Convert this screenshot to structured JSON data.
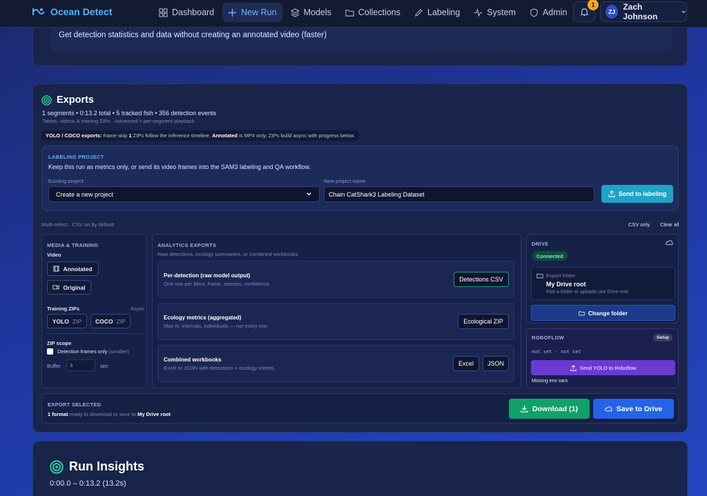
{
  "app": {
    "name": "Ocean Detect"
  },
  "nav": {
    "items": [
      {
        "label": "Dashboard",
        "icon": "dashboard-icon"
      },
      {
        "label": "New Run",
        "icon": "plus-icon"
      },
      {
        "label": "Models",
        "icon": "layers-icon"
      },
      {
        "label": "Collections",
        "icon": "folder-icon"
      },
      {
        "label": "Labeling",
        "icon": "pencil-icon"
      },
      {
        "label": "System",
        "icon": "activity-icon"
      },
      {
        "label": "Admin",
        "icon": "shield-icon"
      }
    ],
    "active": "New Run"
  },
  "notifications": {
    "count": "1"
  },
  "user": {
    "initials": "ZJ",
    "name": "Zach Johnson"
  },
  "top_card": {
    "text": "Get detection statistics and data without creating an annotated video (faster)"
  },
  "exports": {
    "title": "Exports",
    "stats": "1 segments • 0:13.2 total • 5 tracked fish • 356 detection events",
    "substats": "Tables, videos & training ZIPs · Advanced = per-segment playback",
    "notice": {
      "b1": "YOLO / COCO exports:",
      "t1": " frame skip ",
      "b2": "1",
      "t2": " ZIPs follow the inference timeline. ",
      "b3": "Annotated",
      "t3": " is MP4 only; ZIPs build async with progress below."
    },
    "labeling": {
      "title": "LABELING PROJECT",
      "desc": "Keep this run as metrics only, or send its video frames into the SAM3 labeling and QA workflow.",
      "existing_label": "Existing project",
      "existing_value": "Create a new project",
      "new_label": "New project name",
      "new_value": "Chain CatShark3 Labeling Dataset",
      "send_label": "Send to labeling"
    },
    "multiselect": "Multi-select · CSV on by default",
    "csv_only": "CSV only",
    "clear_all": "Clear all",
    "media": {
      "title": "MEDIA & TRAINING",
      "video_label": "Video",
      "annotated": "Annotated",
      "original": "Original",
      "training_label": "Training ZIPs",
      "async": "Async",
      "yolo": "YOLO",
      "coco": "COCO",
      "zip": "ZIP",
      "scope_label": "ZIP scope",
      "detection_only": "Detection frames only",
      "smaller": "(smaller)",
      "buffer_label": "Buffer",
      "buffer_value": "3",
      "sec": "sec"
    },
    "analytics": {
      "title": "ANALYTICS EXPORTS",
      "subtitle": "Raw detections, ecology summaries, or combined workbooks.",
      "rows": [
        {
          "title": "Per-detection (raw model output)",
          "desc": "One row per bbox: frame, species, confidence.",
          "buttons": [
            "Detections CSV"
          ]
        },
        {
          "title": "Ecology metrics (aggregated)",
          "desc": "Max-N, intervals, individuals — not every row.",
          "buttons": [
            "Ecological ZIP"
          ]
        },
        {
          "title": "Combined workbooks",
          "desc": "Excel or JSON with detections + ecology sheets.",
          "buttons": [
            "Excel",
            "JSON"
          ]
        }
      ]
    },
    "drive": {
      "title": "DRIVE",
      "status": "Connected",
      "folder_label": "Export folder",
      "folder_name": "My Drive root",
      "folder_hint": "Pick a folder or uploads use Drive root.",
      "change_label": "Change folder"
    },
    "roboflow": {
      "title": "ROBOFLOW",
      "setup": "Setup",
      "status": "not set · not set",
      "send_label": "Send YOLO to Roboflow",
      "env": "Missing env vars"
    },
    "export_selected": {
      "title": "EXPORT SELECTED",
      "count": "1 format",
      "mid": " ready to download or save to ",
      "dest": "My Drive root",
      "end": ".",
      "download": "Download (1)",
      "save": "Save to Drive"
    }
  },
  "insights": {
    "title": "Run Insights",
    "range": "0:00.0 – 0:13.2 (13.2s)"
  },
  "colors": {
    "accent": "#4fb4ff",
    "download": "#11a06a",
    "save": "#2463e8",
    "send_labeling": "#1fa3c8",
    "roboflow": "#6a3bd0"
  }
}
